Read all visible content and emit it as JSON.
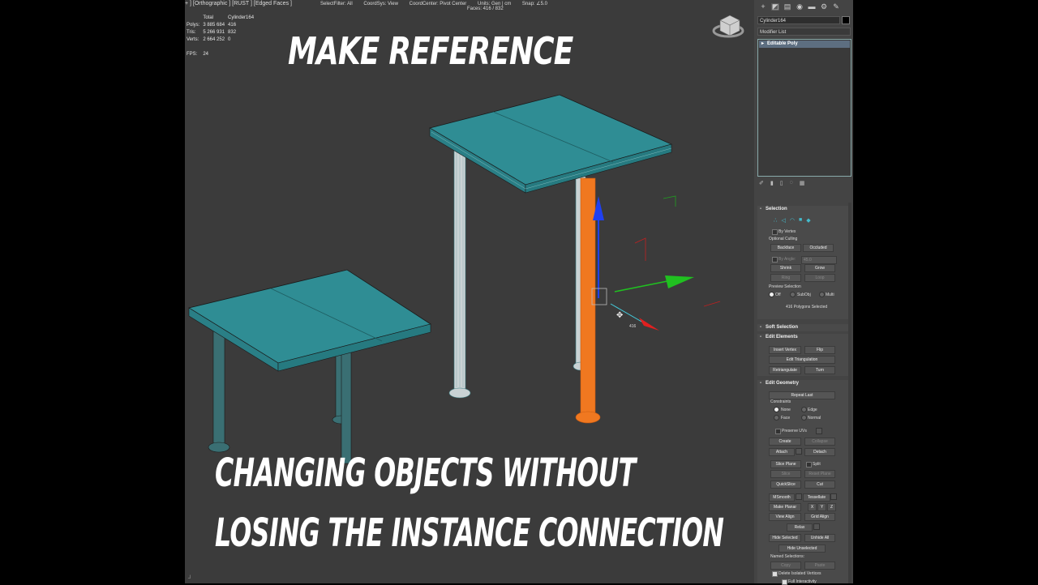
{
  "viewport": {
    "label": "+ ] [Orthographic ] [RUST ] [Edged Faces ]",
    "status": {
      "select_filter": "SelectFilter: All",
      "coord_sys": "CoordSys: View",
      "coord_center": "CoordCenter: Pivot Center",
      "units": "Units: Gen | cm",
      "snap": "Snap: ∠5.0",
      "faces": "Faces: 416 / 832"
    },
    "stats": {
      "header_total": "Total",
      "header_object": "Cylinder164",
      "polys_label": "Polys:",
      "polys_total": "3 885 684",
      "polys_obj": "416",
      "tris_label": "Tris:",
      "tris_total": "5 266 931",
      "tris_obj": "832",
      "verts_label": "Verts:",
      "verts_total": "2 664 252",
      "verts_obj": "0",
      "fps_label": "FPS:",
      "fps_value": "24"
    },
    "gizmo_label": "416"
  },
  "overlay": {
    "title_top": "MAKE REFERENCE",
    "title_line1": "CHANGING OBJECTS WITHOUT",
    "title_line2": "LOSING THE INSTANCE CONNECTION"
  },
  "colors": {
    "table_top": "#2f8d94",
    "selected_leg": "#f07820",
    "viewport_bg": "#3b3b3b",
    "panel_bg": "#444444",
    "gizmo_x": "#e02020",
    "gizmo_y": "#20c020",
    "gizmo_z": "#2040f0"
  },
  "panel": {
    "tabs": [
      "plus-icon",
      "modify-icon",
      "hierarchy-icon",
      "motion-icon",
      "display-icon",
      "utilities-icon",
      "wrench-icon"
    ],
    "object_name": "Cylinder164",
    "modifier_list": "Modifier List",
    "stack_item": "Editable Poly",
    "selection": {
      "header": "Selection",
      "by_vertex": "By Vertex",
      "optional_culling": "Optional Culling",
      "backface": "Backface",
      "occluded": "Occluded",
      "by_angle": "By Angle:",
      "angle_value": "45.0",
      "shrink": "Shrink",
      "grow": "Grow",
      "ring": "Ring",
      "loop": "Loop",
      "preview_selection": "Preview Selection",
      "off": "Off",
      "subobj": "SubObj",
      "multi": "Multi",
      "selected_info": "416 Polygons Selected"
    },
    "soft_selection": {
      "header": "Soft Selection"
    },
    "edit_elements": {
      "header": "Edit Elements",
      "insert_vertex": "Insert Vertex",
      "flip": "Flip",
      "edit_triangulation": "Edit Triangulation",
      "retriangulate": "Retriangulate",
      "turn": "Turn"
    },
    "edit_geometry": {
      "header": "Edit Geometry",
      "repeat_last": "Repeat Last",
      "constraints": "Constraints",
      "none": "None",
      "edge": "Edge",
      "face": "Face",
      "normal": "Normal",
      "preserve_uvs": "Preserve UVs",
      "create": "Create",
      "collapse": "Collapse",
      "attach": "Attach",
      "detach": "Detach",
      "slice_plane": "Slice Plane",
      "split": "Split",
      "slice": "Slice",
      "reset_plane": "Reset Plane",
      "quickslice": "QuickSlice",
      "cut": "Cut",
      "msmooth": "MSmooth",
      "tessellate": "Tessellate",
      "make_planar": "Make Planar",
      "x": "X",
      "y": "Y",
      "z": "Z",
      "view_align": "View Align",
      "grid_align": "Grid Align",
      "relax": "Relax",
      "hide_selected": "Hide Selected",
      "unhide_all": "Unhide All",
      "hide_unselected": "Hide Unselected",
      "named_selections": "Named Selections:",
      "copy": "Copy",
      "paste": "Paste",
      "delete_isolated": "Delete Isolated Vertices",
      "full_interactivity": "Full Interactivity"
    }
  }
}
